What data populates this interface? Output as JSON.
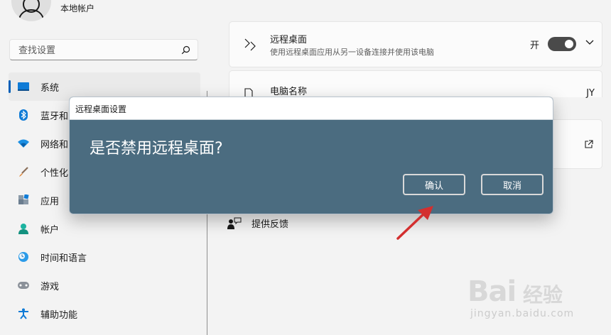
{
  "account": {
    "label": "本地帐户"
  },
  "search": {
    "placeholder": "查找设置"
  },
  "sidebar": {
    "items": [
      {
        "label": "系统",
        "icon": "system-icon",
        "active": true
      },
      {
        "label": "蓝牙和",
        "icon": "bluetooth-icon"
      },
      {
        "label": "网络和",
        "icon": "wifi-icon"
      },
      {
        "label": "个性化",
        "icon": "brush-icon"
      },
      {
        "label": "应用",
        "icon": "apps-icon"
      },
      {
        "label": "帐户",
        "icon": "account-icon"
      },
      {
        "label": "时间和语言",
        "icon": "time-language-icon"
      },
      {
        "label": "游戏",
        "icon": "gamepad-icon"
      },
      {
        "label": "辅助功能",
        "icon": "accessibility-icon"
      }
    ]
  },
  "content": {
    "remote_desktop": {
      "title": "远程桌面",
      "subtitle": "使用远程桌面应用从另一设备连接并使用该电脑",
      "toggle_state": "开",
      "toggle_on": true
    },
    "pc_name": {
      "title": "电脑名称",
      "value": "JY"
    },
    "feedback": {
      "label": "提供反馈"
    }
  },
  "dialog": {
    "title": "远程桌面设置",
    "question": "是否禁用远程桌面?",
    "confirm_label": "确认",
    "cancel_label": "取消"
  },
  "watermark": {
    "brand": "Bai",
    "sub": "经验",
    "url": "jingyan.baidu.com"
  },
  "colors": {
    "accent": "#005fb8",
    "dialog_bg": "#4b6c80",
    "arrow": "#d32f2f"
  }
}
